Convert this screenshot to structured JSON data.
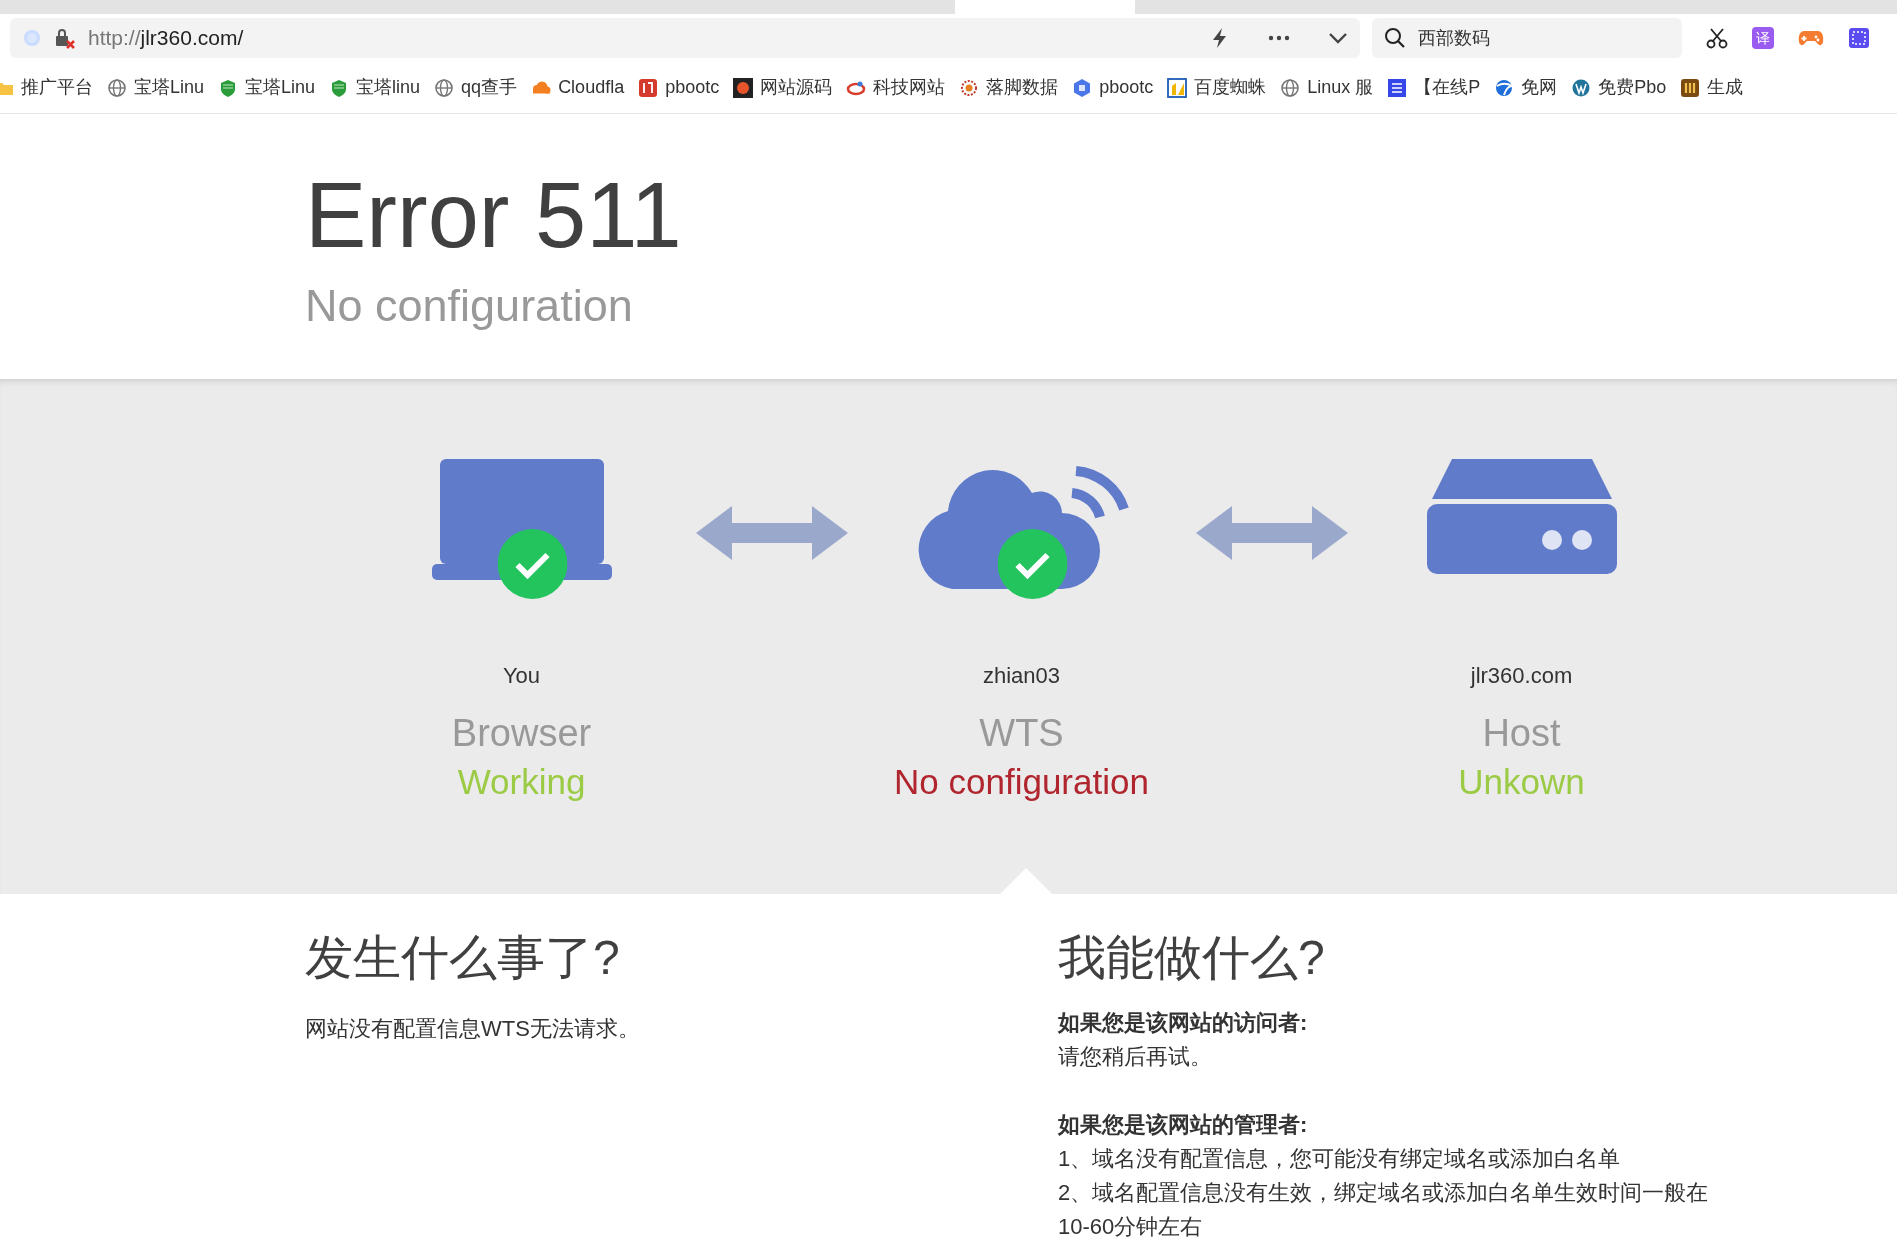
{
  "browser": {
    "tabs": [
      {
        "selected": false
      },
      {
        "selected": true
      },
      {
        "selected": false
      }
    ],
    "url": {
      "scheme": "http://",
      "rest": "jlr360.com/"
    },
    "search": {
      "value": "西部数码"
    },
    "translate_label": "译",
    "bookmarks": [
      {
        "label": "推广平台",
        "kind": "folder"
      },
      {
        "label": "宝塔Linu",
        "kind": "globe"
      },
      {
        "label": "宝塔Linu",
        "kind": "shield"
      },
      {
        "label": "宝塔linu",
        "kind": "shield"
      },
      {
        "label": "qq查手",
        "kind": "globe"
      },
      {
        "label": "Cloudfla",
        "kind": "cloud"
      },
      {
        "label": "pbootc",
        "kind": "red"
      },
      {
        "label": "网站源码",
        "kind": "sun"
      },
      {
        "label": "科技网站",
        "kind": "swirl"
      },
      {
        "label": "落脚数据",
        "kind": "stamp"
      },
      {
        "label": "pbootc",
        "kind": "hex"
      },
      {
        "label": "百度蜘蛛",
        "kind": "chart"
      },
      {
        "label": "Linux 服",
        "kind": "globe"
      },
      {
        "label": "【在线P",
        "kind": "blue"
      },
      {
        "label": "免网",
        "kind": "bird"
      },
      {
        "label": "免费Pbo",
        "kind": "wp"
      },
      {
        "label": "生成",
        "kind": "box"
      }
    ]
  },
  "error": {
    "title": "Error 511",
    "subtitle": "No configuration"
  },
  "nodes": [
    {
      "kind": "laptop",
      "checked": true,
      "name": "You",
      "role": "Browser",
      "status": "Working",
      "ok": true
    },
    {
      "kind": "cloud",
      "checked": true,
      "name": "zhian03",
      "role": "WTS",
      "status": "No configuration",
      "ok": false
    },
    {
      "kind": "server",
      "checked": false,
      "name": "jlr360.com",
      "role": "Host",
      "status": "Unkown",
      "ok": true
    }
  ],
  "what_happened": {
    "heading": "发生什么事了?",
    "text": "网站没有配置信息WTS无法请求。"
  },
  "what_to_do": {
    "heading": "我能做什么?",
    "sections": [
      {
        "title": "如果您是该网站的访问者:",
        "lines": [
          "请您稍后再试。"
        ]
      },
      {
        "title": "如果您是该网站的管理者:",
        "lines": [
          "1、域名没有配置信息，您可能没有绑定域名或添加白名单",
          "2、域名配置信息没有生效，绑定域名或添加白名单生效时间一般在",
          "10-60分钟左右"
        ]
      }
    ]
  }
}
